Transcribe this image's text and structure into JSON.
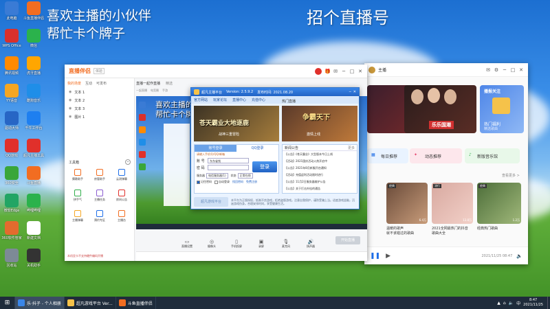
{
  "overlay": {
    "line1": "喜欢主播的小伙伴",
    "line2": "帮忙卡个牌子",
    "right_title": "招个直播号"
  },
  "desktop_icons": [
    {
      "label": "此电脑",
      "icon": "computer-icon",
      "color": "#3a7bd5"
    },
    {
      "label": "斗鱼直播伴侣",
      "icon": "douyu-icon",
      "color": "#f26d21"
    },
    {
      "label": "WPS Office",
      "icon": "wps-icon",
      "color": "#d9302c"
    },
    {
      "label": "微信",
      "icon": "wechat-icon",
      "color": "#2bb24c"
    },
    {
      "label": "腾讯视频",
      "icon": "tencent-video-icon",
      "color": "#ff8a00"
    },
    {
      "label": "虎牙直播",
      "icon": "huya-icon",
      "color": "#ffa600"
    },
    {
      "label": "YY语音",
      "icon": "yy-icon",
      "color": "#f5a623"
    },
    {
      "label": "酷狗音乐",
      "icon": "kugou-icon",
      "color": "#1f8ee8"
    },
    {
      "label": "驱动大师",
      "icon": "driver-icon",
      "color": "#2766c5"
    },
    {
      "label": "千牛工作台",
      "icon": "qianniu-icon",
      "color": "#1e7ff0"
    },
    {
      "label": "QQ游戏",
      "icon": "qqgame-icon",
      "color": "#e0302b"
    },
    {
      "label": "超凡主播工具",
      "icon": "anchor-tool-icon",
      "color": "#e0302b"
    },
    {
      "label": "360安全",
      "icon": "shield-icon",
      "color": "#3aa63a"
    },
    {
      "label": "斗鱼直播",
      "icon": "douyu-live-icon",
      "color": "#f26d21"
    },
    {
      "label": "微软Edge",
      "icon": "edge-icon",
      "color": "#22a564"
    },
    {
      "label": "哔哩哔哩",
      "icon": "bilibili-icon",
      "color": "#2bb24c"
    },
    {
      "label": "360软件管家",
      "icon": "apps-icon",
      "color": "#e36b2e"
    },
    {
      "label": "新建文档",
      "icon": "document-icon",
      "color": "#ffffff"
    },
    {
      "label": "回收站",
      "icon": "recycle-icon",
      "color": "#7d8a96"
    },
    {
      "label": "关机助手",
      "icon": "power-icon",
      "color": "#333333"
    }
  ],
  "obs_window": {
    "logo": "直播伴侣",
    "badge": "体验",
    "tabs": [
      "我的场景",
      "互动",
      "可发布"
    ],
    "scene_items": [
      "文本 1",
      "文本 2",
      "文本 3",
      "图片 1"
    ],
    "tools_title": "工具箱",
    "tools": [
      "猜歌助手",
      "房管助手",
      "云测弹幕",
      "拼手气",
      "主播任务",
      "房间公告",
      "主播弹幕",
      "预约专区",
      "主播台"
    ],
    "status_footer": "本机显卡不支持硬件编码开播",
    "mid_tabs": [
      "直播一起作直播",
      "精选"
    ],
    "mid_sub": [
      "一起直播",
      "电竞圈",
      "手游"
    ],
    "bottom_controls": [
      "直播设置",
      "摄像头",
      "手机投屏",
      "录屏",
      "麦克风",
      "扬声器"
    ],
    "start_button": "开始直播"
  },
  "login_window": {
    "title": "超凡主播平台",
    "version": "Version: 2.5.9.2",
    "date": "发布时间: 2021.08.20",
    "nav": [
      "官方网站",
      "玩家论坛",
      "直播中心",
      "充值中心"
    ],
    "hot_section": "热门直播",
    "banner1": "苍天霸业大地逐鹿",
    "banner1_sub": "战神三重冒险",
    "banner2": "争霸天下",
    "banner2_sub": "激情上线",
    "tabs": [
      "账号登录",
      "QQ登录"
    ],
    "hint": "请输入手机号/QQ/邮箱",
    "account_label": "账 号",
    "account_value": "东东省钱",
    "password_label": "密 码",
    "login_button": "登录",
    "server_label": "服务器",
    "server_value": "电信服务器(1)",
    "status_label": "状态",
    "status_value": "正常在线",
    "checkboxes": [
      "记住密码",
      "自动登录"
    ],
    "links": [
      "找回密码",
      "免费注册"
    ],
    "news_title": "新闻公告",
    "news_more": "更多",
    "news": [
      "【公告】《苍天霸业》大型版本今日上线",
      "【活动】2021国庆活动火热开启中",
      "【公告】2021年8月新服开启通知",
      "【活动】充值返利活动限时进行",
      "【公告】11月2日服务器维护公告",
      "【公告】关于打击外挂的通告"
    ],
    "footer_logo": "超凡游戏平台",
    "footer_text": "本平台为正版授权，抵制不良游戏，拒绝盗版游戏。注意自我保护，谨防受骗上当。适度游戏益脑，沉迷游戏伤身。合理安排时间，享受健康生活。"
  },
  "browser_window": {
    "user": "主播",
    "banner_text": "乐乐国潮",
    "gift_title": "播报关注",
    "gift_sub": "热门福利",
    "gift_note": "精选歌曲",
    "shortcuts": [
      "每日推荐",
      "动态推荐",
      "新版音乐馆"
    ],
    "section_more": "查看更多 >",
    "videos": [
      {
        "tag": "经典",
        "title": "温暖的歌声",
        "sub": "就不该错过的歌曲",
        "views": "6.4万"
      },
      {
        "tag": "流行",
        "title": "2021全网最热门的抖音",
        "sub": "歌曲大全",
        "views": "13.8万"
      },
      {
        "tag": "经典",
        "title": "经典热门歌曲",
        "sub": "",
        "views": "1.2万"
      }
    ],
    "player_time": "2021/11/25 08:47"
  },
  "taskbar": {
    "items": [
      "乐·抖子 - 个人相册",
      "超凡游戏平台 Ver...",
      "斗鱼直播伴侣"
    ],
    "time": "8:47",
    "date": "2021/11/25"
  }
}
